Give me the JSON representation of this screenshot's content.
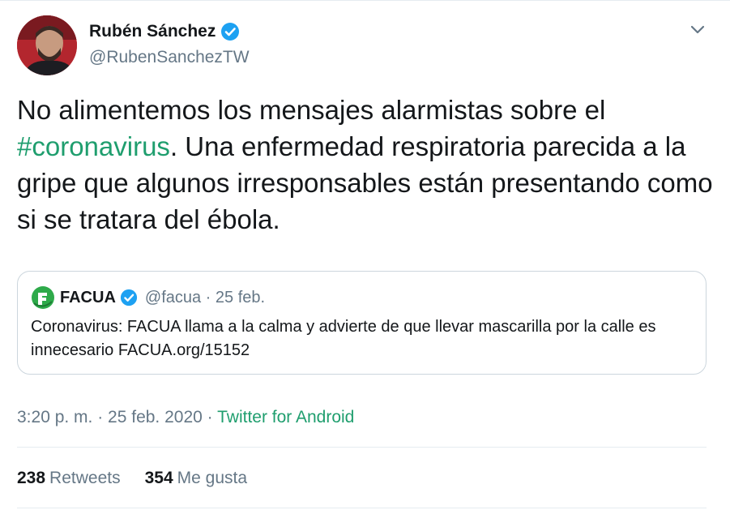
{
  "author": {
    "name": "Rubén Sánchez",
    "handle": "@RubenSanchezTW",
    "verified_color": "#1da1f2"
  },
  "tweet": {
    "text_before": "No alimentemos los mensajes alarmistas sobre el",
    "hashtag": "#coronavirus",
    "text_after": ". Una enfermedad respiratoria parecida a la gripe que algunos irresponsables están presentando como si se tratara del ébola."
  },
  "quoted_tweet": {
    "name": "FACUA",
    "handle_date": "@facua · 25 feb.",
    "text": "Coronavirus: FACUA llama a la calma y advierte de que llevar mascarilla por la calle es innecesario FACUA.org/15152",
    "logo_icon": "facua-logo-icon",
    "logo_color": "#2eaa4a"
  },
  "meta": {
    "time_date": "3:20 p. m. · 25 feb. 2020 · ",
    "source": "Twitter for Android"
  },
  "stats": {
    "retweets_count": "238",
    "retweets_label": "Retweets",
    "likes_count": "354",
    "likes_label": "Me gusta"
  },
  "colors": {
    "link": "#1f9e6e",
    "secondary_text": "#657786",
    "border": "#e6ecf0"
  }
}
